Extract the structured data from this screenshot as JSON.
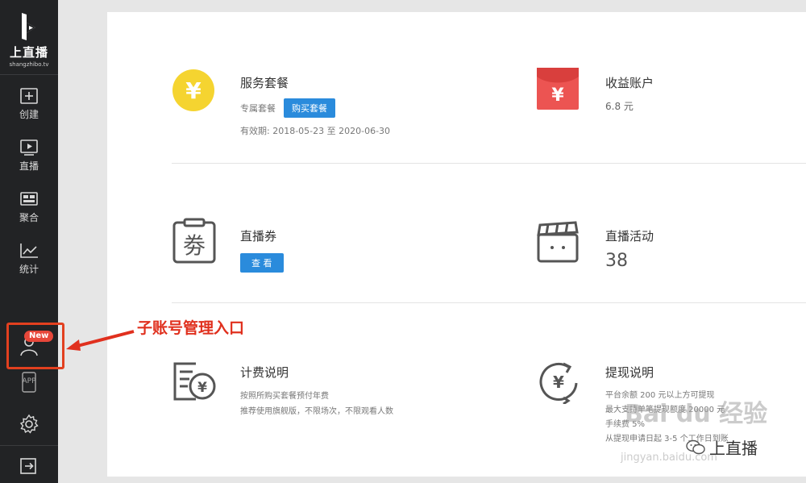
{
  "sidebar": {
    "brand": "上直播",
    "domain": "shangzhibo.tv",
    "items": [
      {
        "label": "创建",
        "icon": "plus-square-icon"
      },
      {
        "label": "直播",
        "icon": "play-screen-icon"
      },
      {
        "label": "聚合",
        "icon": "grid-icon"
      },
      {
        "label": "统计",
        "icon": "line-chart-icon"
      }
    ],
    "sub_account": {
      "badge": "New",
      "icon": "user-icon"
    },
    "app_label": "APP",
    "settings_icon": "gear-icon",
    "logout_icon": "logout-icon"
  },
  "cards": {
    "service": {
      "title": "服务套餐",
      "sub": "专属套餐",
      "button": "购买套餐",
      "validity": "有效期: 2018-05-23 至 2020-06-30",
      "icon_char": "¥"
    },
    "earnings": {
      "title": "收益账户",
      "value": "6.8 元",
      "icon_char": "¥"
    },
    "ticket": {
      "title": "直播券",
      "button": "查 看",
      "icon_char": "劵"
    },
    "activity": {
      "title": "直播活动",
      "value": "38"
    },
    "billing": {
      "title": "计费说明",
      "line1": "按照所购买套餐预付年费",
      "line2": "推荐使用旗舰版，不限场次，不限观看人数",
      "icon_char": "¥"
    },
    "withdraw": {
      "title": "提现说明",
      "line1": "平台余额 200 元以上方可提现",
      "line2": "最大支持单笔提现额度 20000 元",
      "line3": "手续费 5%",
      "line4": "从提现申请日起 3-5 个工作日到账",
      "icon_char": "¥"
    }
  },
  "annotation": "子账号管理入口",
  "watermark": {
    "brand": "Bai du 经验",
    "url": "jingyan.baidu.com",
    "account": "上直播"
  },
  "colors": {
    "sidebar_bg": "#222325",
    "accent_blue": "#2a8bdc",
    "coin_yellow": "#f5d430",
    "redpack_red": "#ec5452",
    "annotation_red": "#e0301e"
  }
}
